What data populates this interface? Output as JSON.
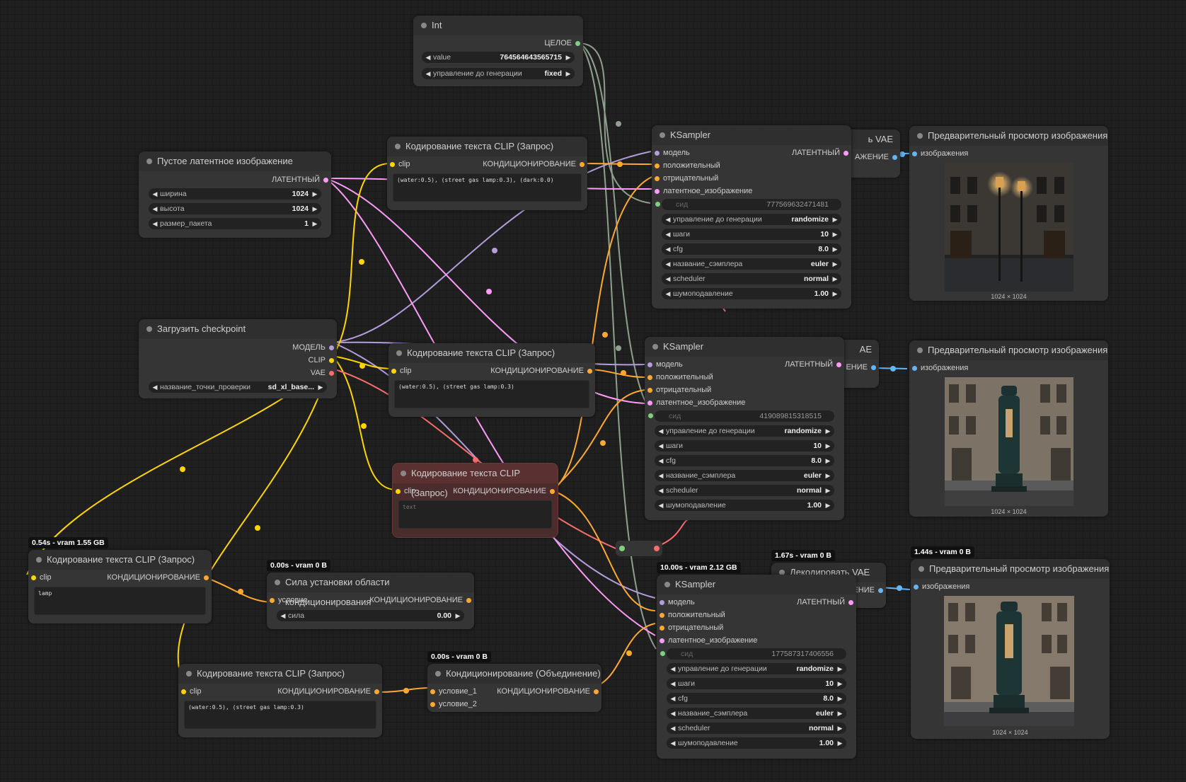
{
  "colors": {
    "clip": "#ffd500",
    "cond": "#ffa931",
    "latent": "#ff9cf9",
    "model": "#b39ddb",
    "vae": "#ff6e6e",
    "int": "#7f9f7f",
    "image": "#64b5f6"
  },
  "int_node": {
    "title": "Int",
    "out": "ЦЕЛОЕ",
    "value_label": "value",
    "value": "764564643565715",
    "control_label": "управление до генерации",
    "control_value": "fixed"
  },
  "empty_latent": {
    "title": "Пустое латентное изображение",
    "out": "ЛАТЕНТНЫЙ",
    "width_label": "ширина",
    "width": "1024",
    "height_label": "высота",
    "height": "1024",
    "batch_label": "размер_пакета",
    "batch": "1"
  },
  "checkpoint": {
    "title": "Загрузить checkpoint",
    "out_model": "МОДЕЛЬ",
    "out_clip": "CLIP",
    "out_vae": "VAE",
    "ckpt_label": "название_точки_проверки",
    "ckpt_value": "sd_xl_base..."
  },
  "clip1": {
    "title": "Кодирование текста CLIP (Запрос)",
    "in": "clip",
    "out": "КОНДИЦИОНИРОВАНИЕ",
    "text": "(water:0.5), (street gas lamp:0.3), (dark:0.0)"
  },
  "clip2": {
    "title": "Кодирование текста CLIP (Запрос)",
    "in": "clip",
    "out": "КОНДИЦИОНИРОВАНИЕ",
    "text": "(water:0.5), (street gas lamp:0.3)"
  },
  "clip3": {
    "title": "Кодирование текста CLIP (Запрос)",
    "in": "clip",
    "out": "КОНДИЦИОНИРОВАНИЕ",
    "text": "text"
  },
  "clip4": {
    "title": "Кодирование текста CLIP (Запрос)",
    "in": "clip",
    "out": "КОНДИЦИОНИРОВАНИЕ",
    "text": "lamp",
    "badge": "0.54s - vram 1.55 GB"
  },
  "clip5": {
    "title": "Кодирование текста CLIP (Запрос)",
    "in": "clip",
    "out": "КОНДИЦИОНИРОВАНИЕ",
    "text": "(water:0.5), (street gas lamp:0.3)"
  },
  "area_strength": {
    "title": "Сила установки области кондиционирования",
    "in": "условие",
    "out": "КОНДИЦИОНИРОВАНИЕ",
    "strength_label": "сила",
    "strength": "0.00",
    "badge": "0.00s - vram 0 B"
  },
  "combine": {
    "title": "Кондиционирование (Объединение)",
    "in1": "условие_1",
    "in2": "условие_2",
    "out": "КОНДИЦИОНИРОВАНИЕ",
    "badge": "0.00s - vram 0 B"
  },
  "ksampler1": {
    "title": "KSampler",
    "in_model": "модель",
    "in_pos": "положительный",
    "in_neg": "отрицательный",
    "in_latent": "латентное_изображение",
    "in_seed": "сид",
    "out": "ЛАТЕНТНЫЙ",
    "seed": "777569632471481",
    "control_label": "управление до генерации",
    "control": "randomize",
    "steps_label": "шаги",
    "steps": "10",
    "cfg_label": "cfg",
    "cfg": "8.0",
    "sampler_label": "название_сэмплера",
    "sampler": "euler",
    "scheduler_label": "scheduler",
    "scheduler": "normal",
    "denoise_label": "шумоподавление",
    "denoise": "1.00"
  },
  "ksampler2": {
    "title": "KSampler",
    "in_model": "модель",
    "in_pos": "положительный",
    "in_neg": "отрицательный",
    "in_latent": "латентное_изображение",
    "in_seed": "сид",
    "out": "ЛАТЕНТНЫЙ",
    "seed": "419089815318515",
    "control_label": "управление до генерации",
    "control": "randomize",
    "steps_label": "шаги",
    "steps": "10",
    "cfg_label": "cfg",
    "cfg": "8.0",
    "sampler_label": "название_сэмплера",
    "sampler": "euler",
    "scheduler_label": "scheduler",
    "scheduler": "normal",
    "denoise_label": "шумоподавление",
    "denoise": "1.00"
  },
  "ksampler3": {
    "title": "KSampler",
    "in_model": "модель",
    "in_pos": "положительный",
    "in_neg": "отрицательный",
    "in_latent": "латентное_изображение",
    "in_seed": "сид",
    "out": "ЛАТЕНТНЫЙ",
    "seed": "177587317406556",
    "control_label": "управление до генерации",
    "control": "randomize",
    "steps_label": "шаги",
    "steps": "10",
    "cfg_label": "cfg",
    "cfg": "8.0",
    "sampler_label": "название_сэмплера",
    "sampler": "euler",
    "scheduler_label": "scheduler",
    "scheduler": "normal",
    "denoise_label": "шумоподавление",
    "denoise": "1.00",
    "badge": "10.00s - vram 2.12 GB"
  },
  "vae1": {
    "title_tail": "ь VAE",
    "out_tail": "АЖЕНИЕ"
  },
  "vae2": {
    "title_tail": "AE",
    "out_tail": "ЕНИЕ"
  },
  "vae3": {
    "title": "Декодировать VAE",
    "out_tail": "ЕНИЕ",
    "badge": "1.67s - vram 0 B"
  },
  "preview1": {
    "title": "Предварительный просмотр изображения",
    "in": "изображения",
    "dims": "1024 × 1024"
  },
  "preview2": {
    "title": "Предварительный просмотр изображения",
    "in": "изображения",
    "dims": "1024 × 1024"
  },
  "preview3": {
    "title": "Предварительный просмотр изображения",
    "in": "изображения",
    "dims": "1024 × 1024",
    "badge": "1.44s - vram 0 B"
  }
}
